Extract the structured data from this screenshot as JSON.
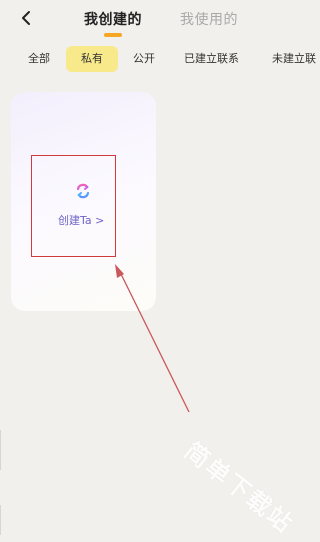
{
  "header": {
    "tabs": [
      {
        "label": "我创建的",
        "active": true
      },
      {
        "label": "我使用的",
        "active": false
      }
    ]
  },
  "filters": {
    "items": [
      {
        "label": "全部",
        "selected": false
      },
      {
        "label": "私有",
        "selected": true
      },
      {
        "label": "公开",
        "selected": false
      },
      {
        "label": "已建立联系",
        "selected": false
      },
      {
        "label": "未建立联"
      }
    ]
  },
  "card": {
    "create_label": "创建Ta >"
  },
  "watermark": {
    "text": "简单下载站"
  },
  "colors": {
    "accent": "#f5a623",
    "chip_selected_bg": "#f8e98a",
    "highlight_box": "#d13a3a",
    "create_label": "#6f63c8",
    "background": "#f2f0ec"
  },
  "icons": {
    "back": "chevron-left-icon",
    "create": "swap-refresh-icon"
  }
}
